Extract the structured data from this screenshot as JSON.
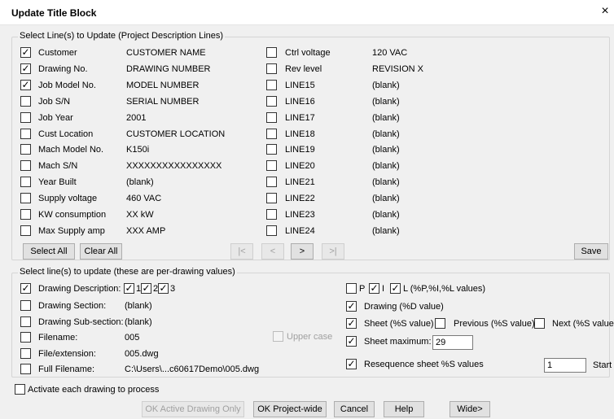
{
  "window": {
    "title": "Update Title Block",
    "close_label": "×"
  },
  "project_group": {
    "legend": "Select Line(s) to Update (Project Description Lines)",
    "left_rows": [
      {
        "checked": true,
        "label": "Customer",
        "value": "CUSTOMER NAME"
      },
      {
        "checked": true,
        "label": "Drawing No.",
        "value": "DRAWING NUMBER"
      },
      {
        "checked": true,
        "label": "Job Model No.",
        "value": "MODEL NUMBER"
      },
      {
        "checked": false,
        "label": "Job S/N",
        "value": "SERIAL NUMBER"
      },
      {
        "checked": false,
        "label": "Job Year",
        "value": "2001"
      },
      {
        "checked": false,
        "label": "Cust Location",
        "value": "CUSTOMER LOCATION"
      },
      {
        "checked": false,
        "label": "Mach Model No.",
        "value": "K150i"
      },
      {
        "checked": false,
        "label": "Mach S/N",
        "value": "XXXXXXXXXXXXXXXX"
      },
      {
        "checked": false,
        "label": "Year Built",
        "value": "(blank)"
      },
      {
        "checked": false,
        "label": "Supply voltage",
        "value": "460 VAC"
      },
      {
        "checked": false,
        "label": "KW consumption",
        "value": "XX kW"
      },
      {
        "checked": false,
        "label": "Max Supply amp",
        "value": "XXX AMP"
      }
    ],
    "right_rows": [
      {
        "checked": false,
        "label": "Ctrl voltage",
        "value": "120 VAC"
      },
      {
        "checked": false,
        "label": "Rev level",
        "value": "REVISION X"
      },
      {
        "checked": false,
        "label": "LINE15",
        "value": "(blank)"
      },
      {
        "checked": false,
        "label": "LINE16",
        "value": "(blank)"
      },
      {
        "checked": false,
        "label": "LINE17",
        "value": "(blank)"
      },
      {
        "checked": false,
        "label": "LINE18",
        "value": "(blank)"
      },
      {
        "checked": false,
        "label": "LINE19",
        "value": "(blank)"
      },
      {
        "checked": false,
        "label": "LINE20",
        "value": "(blank)"
      },
      {
        "checked": false,
        "label": "LINE21",
        "value": "(blank)"
      },
      {
        "checked": false,
        "label": "LINE22",
        "value": "(blank)"
      },
      {
        "checked": false,
        "label": "LINE23",
        "value": "(blank)"
      },
      {
        "checked": false,
        "label": "LINE24",
        "value": "(blank)"
      }
    ],
    "select_all_label": "Select All",
    "clear_all_label": "Clear All",
    "nav": {
      "first": "|<",
      "prev": "<",
      "next": ">",
      "last": ">|"
    },
    "save_label": "Save"
  },
  "drawing_group": {
    "legend": "Select line(s) to update (these are per-drawing values)",
    "drawing_description": {
      "checked": true,
      "label": "Drawing Description:",
      "options": [
        {
          "checked": true,
          "label": "1"
        },
        {
          "checked": true,
          "label": "2"
        },
        {
          "checked": true,
          "label": "3"
        }
      ]
    },
    "rows": [
      {
        "checked": false,
        "label": "Drawing Section:",
        "value": "(blank)"
      },
      {
        "checked": false,
        "label": "Drawing Sub-section:",
        "value": "(blank)"
      },
      {
        "checked": false,
        "label": "Filename:",
        "value": "005"
      },
      {
        "checked": false,
        "label": "File/extension:",
        "value": "005.dwg"
      },
      {
        "checked": false,
        "label": "Full Filename:",
        "value": "C:\\Users\\...c60617Demo\\005.dwg"
      }
    ],
    "upper_case": {
      "checked": false,
      "label": "Upper case"
    },
    "pil": {
      "p": {
        "checked": false,
        "label": "P"
      },
      "i": {
        "checked": true,
        "label": "I"
      },
      "l": {
        "checked": true,
        "label": "L (%P,%I,%L values)"
      }
    },
    "drawing_d": {
      "checked": true,
      "label": "Drawing (%D value)"
    },
    "sheet": {
      "checked": true,
      "label": "Sheet (%S value)"
    },
    "previous": {
      "checked": false,
      "label": "Previous (%S value)"
    },
    "next": {
      "checked": false,
      "label": "Next (%S value)"
    },
    "sheet_max": {
      "checked": true,
      "label": "Sheet maximum:",
      "value": "29"
    },
    "resequence": {
      "checked": true,
      "label": "Resequence sheet %S values",
      "value": "1",
      "start_label": "Start"
    }
  },
  "activate": {
    "checked": false,
    "label": "Activate each drawing to process"
  },
  "buttons": {
    "ok_active": "OK Active Drawing Only",
    "ok_project": "OK Project-wide",
    "cancel": "Cancel",
    "help": "Help",
    "wide": "Wide>"
  }
}
